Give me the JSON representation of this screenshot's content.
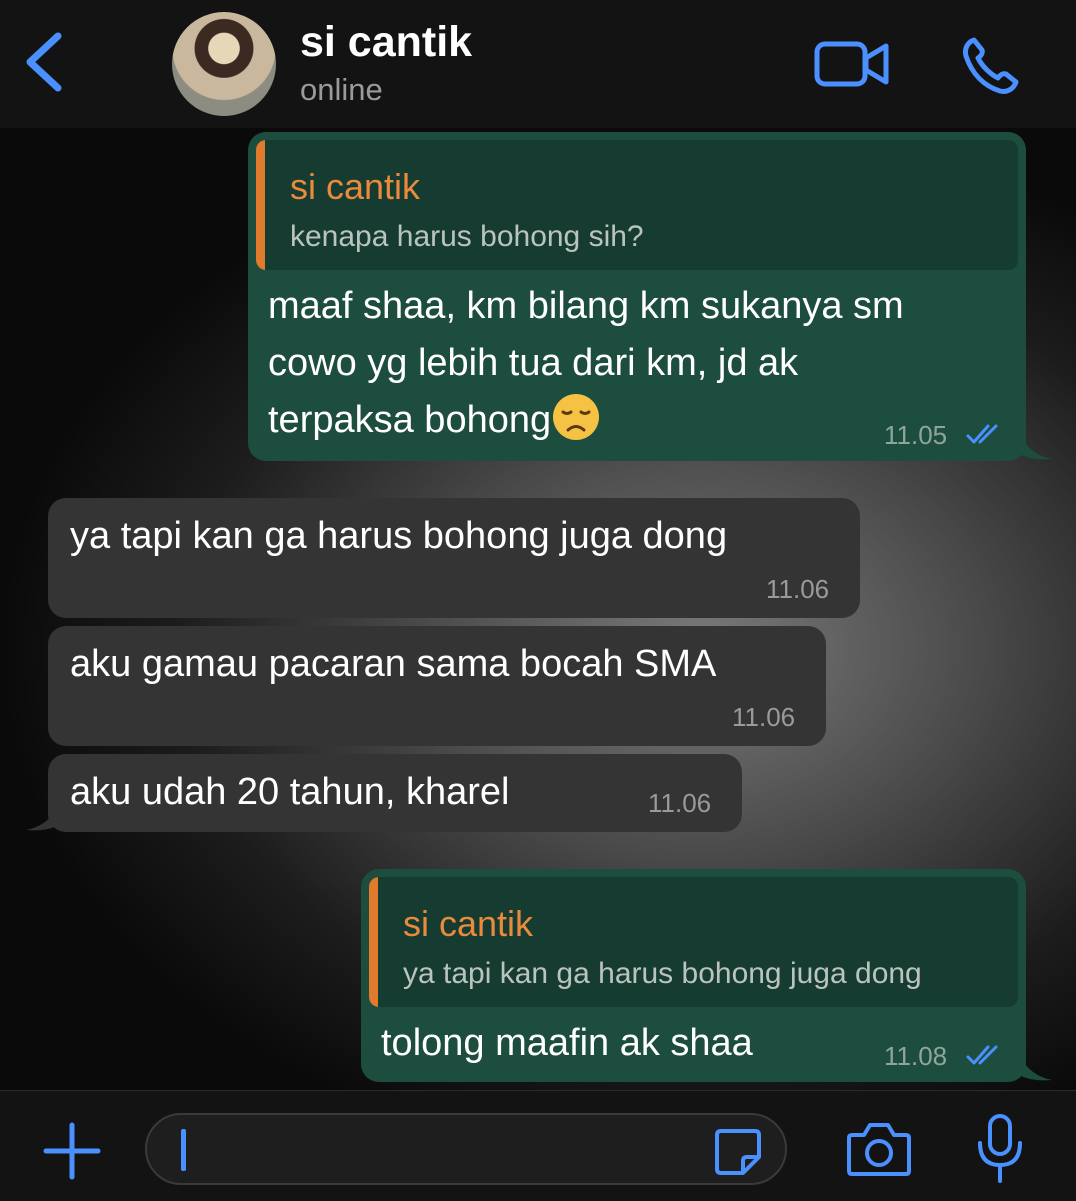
{
  "header": {
    "title": "si cantik",
    "status": "online"
  },
  "messages": [
    {
      "direction": "outgoing",
      "quote_name": "si cantik",
      "quote_text": "kenapa harus bohong sih?",
      "lines": [
        "maaf shaa, km bilang km sukanya sm",
        "cowo yg lebih tua dari km, jd ak",
        "terpaksa bohong"
      ],
      "emoji": "disappointed-face",
      "time": "11.05",
      "status": "read"
    },
    {
      "direction": "incoming",
      "text": "ya tapi kan ga harus bohong juga dong",
      "time": "11.06"
    },
    {
      "direction": "incoming",
      "text": "aku gamau pacaran sama bocah SMA",
      "time": "11.06"
    },
    {
      "direction": "incoming",
      "text": "aku udah 20 tahun, kharel",
      "time": "11.06"
    },
    {
      "direction": "outgoing",
      "quote_name": "si cantik",
      "quote_text": "ya tapi kan ga harus bohong juga dong",
      "text": "tolong maafin ak shaa",
      "time": "11.08",
      "status": "read"
    }
  ],
  "input": {
    "value": "",
    "placeholder": ""
  },
  "colors": {
    "accent": "#4a90ff",
    "outgoing_bubble": "#1d4d3e",
    "incoming_bubble": "#343434",
    "quote_name": "#e98a3c"
  },
  "icons": [
    "back-chevron-icon",
    "video-call-icon",
    "phone-icon",
    "plus-icon",
    "sticker-icon",
    "camera-icon",
    "microphone-icon",
    "double-check-icon"
  ]
}
